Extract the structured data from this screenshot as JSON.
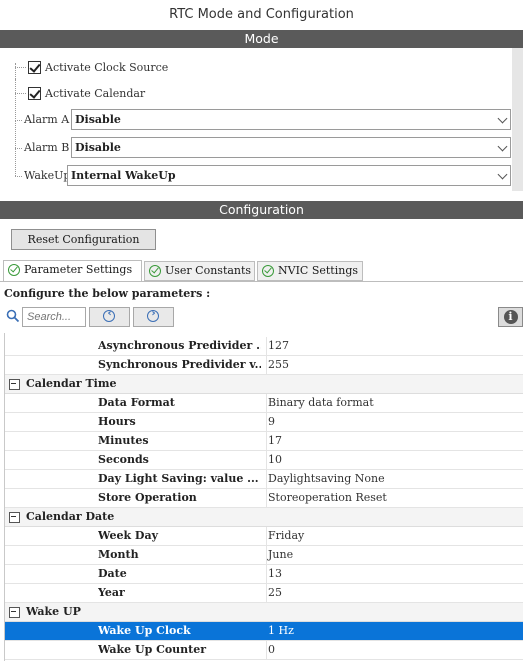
{
  "window": {
    "title": "RTC Mode and Configuration"
  },
  "mode": {
    "header": "Mode",
    "activate_clock_source": {
      "label": "Activate Clock Source",
      "checked": true
    },
    "activate_calendar": {
      "label": "Activate Calendar",
      "checked": true
    },
    "alarm_a": {
      "label": "Alarm A",
      "value": "Disable"
    },
    "alarm_b": {
      "label": "Alarm B",
      "value": "Disable"
    },
    "wakeup": {
      "label": "WakeUp",
      "value": "Internal WakeUp"
    }
  },
  "configuration": {
    "header": "Configuration",
    "reset_button": "Reset Configuration",
    "tabs": [
      {
        "label": "Parameter Settings",
        "active": true
      },
      {
        "label": "User Constants",
        "active": false
      },
      {
        "label": "NVIC Settings",
        "active": false
      }
    ],
    "instructions": "Configure the below parameters :",
    "search": {
      "placeholder": "Search..."
    },
    "nav_prev_icon": "arrow-left-circle-icon",
    "nav_next_icon": "arrow-right-circle-icon",
    "info_icon": "info-icon",
    "info_glyph": "i",
    "nav_prev_glyph": "‹",
    "nav_next_glyph": "›"
  },
  "params": {
    "rows": [
      {
        "name": "Asynchronous Predivider ...",
        "value": "127"
      },
      {
        "name": "Synchronous Predivider v...",
        "value": "255"
      }
    ],
    "groups": [
      {
        "name": "Calendar Time",
        "rows": [
          {
            "name": "Data Format",
            "value": "Binary data format"
          },
          {
            "name": "Hours",
            "value": "9"
          },
          {
            "name": "Minutes",
            "value": "17"
          },
          {
            "name": "Seconds",
            "value": "10"
          },
          {
            "name": "Day Light Saving: value ...",
            "value": "Daylightsaving None"
          },
          {
            "name": "Store Operation",
            "value": "Storeoperation Reset"
          }
        ]
      },
      {
        "name": "Calendar Date",
        "rows": [
          {
            "name": "Week Day",
            "value": "Friday"
          },
          {
            "name": "Month",
            "value": "June"
          },
          {
            "name": "Date",
            "value": "13"
          },
          {
            "name": "Year",
            "value": "25"
          }
        ]
      },
      {
        "name": "Wake UP",
        "rows": [
          {
            "name": "Wake Up Clock",
            "value": "1 Hz",
            "selected": true
          },
          {
            "name": "Wake Up Counter",
            "value": "0"
          }
        ]
      }
    ]
  },
  "colors": {
    "section_bar": "#5a5a5a",
    "selection": "#0a74d8",
    "check_icon": "#3a9a3a",
    "nav_icon": "#3b6fb6"
  }
}
